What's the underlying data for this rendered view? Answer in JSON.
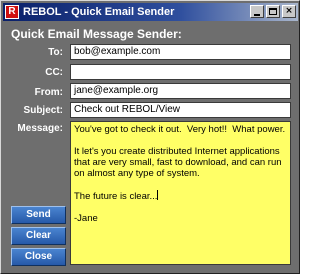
{
  "window": {
    "title": "REBOL - Quick Email Sender",
    "icon_letter": "R",
    "controls": [
      "minimize-icon",
      "maximize-icon",
      "close-icon"
    ],
    "close_glyph": "×"
  },
  "form": {
    "heading": "Quick Email Message Sender:",
    "to_label": "To:",
    "to_value": "bob@example.com",
    "cc_label": "CC:",
    "cc_value": "",
    "from_label": "From:",
    "from_value": "jane@example.org",
    "subject_label": "Subject:",
    "subject_value": "Check out REBOL/View",
    "message_label": "Message:",
    "message_value": "You've got to check it out.  Very hot!!  What power.\n\nIt let's you create distributed Internet applications that are very small, fast to download, and can run on almost any type of system.\n\nThe future is clear..."
  },
  "message_tail": "\n\n-Jane",
  "buttons": {
    "send": "Send",
    "clear": "Clear",
    "close": "Close"
  },
  "colors": {
    "panel": "#6e6e6e",
    "message_bg": "#ffff66",
    "button": "#2c66b2",
    "titlebar": "#0a2069"
  }
}
